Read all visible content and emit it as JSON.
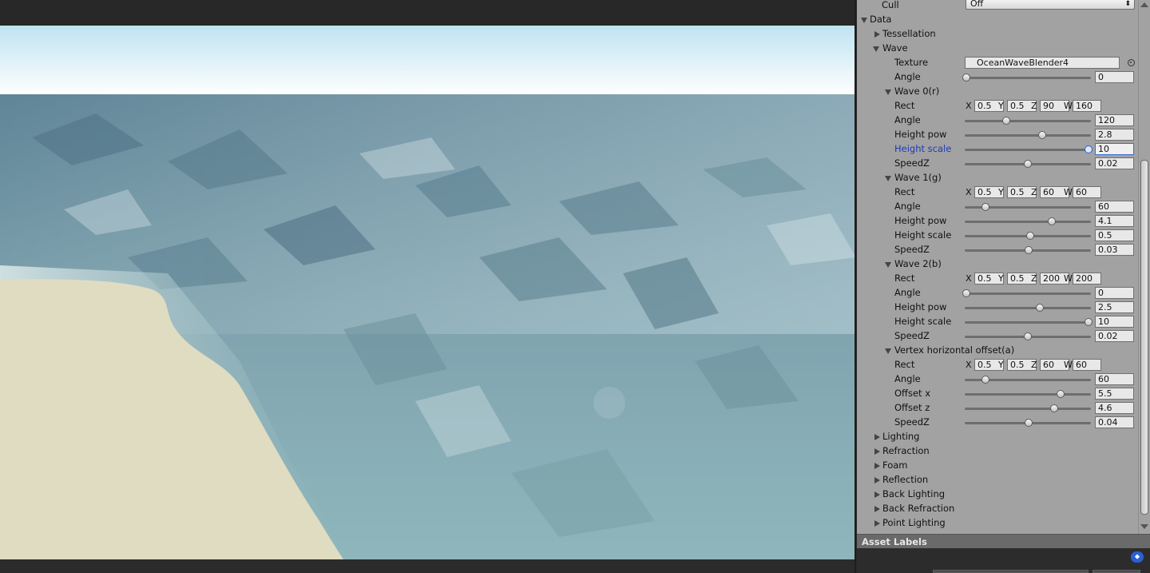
{
  "inspector": {
    "cull": {
      "label": "Cull",
      "value": "Off"
    },
    "data_section": "Data",
    "tessellation": "Tessellation",
    "wave_section": "Wave",
    "texture": {
      "label": "Texture",
      "value": "OceanWaveBlender4"
    },
    "global_angle": {
      "label": "Angle",
      "value": "0",
      "fraction": 0.0
    },
    "waves": [
      {
        "title": "Wave 0(r)",
        "rect": {
          "label": "Rect",
          "x": "0.5",
          "y": "0.5",
          "z": "90",
          "w": "160"
        },
        "sliders": [
          {
            "label": "Angle",
            "value": "120",
            "fraction": 0.33
          },
          {
            "label": "Height pow",
            "value": "2.8",
            "fraction": 0.62
          },
          {
            "label": "Height scale",
            "value": "10",
            "fraction": 1.0,
            "focused": true
          },
          {
            "label": "SpeedZ",
            "value": "0.02",
            "fraction": 0.5
          }
        ]
      },
      {
        "title": "Wave 1(g)",
        "rect": {
          "label": "Rect",
          "x": "0.5",
          "y": "0.5",
          "z": "60",
          "w": "60"
        },
        "sliders": [
          {
            "label": "Angle",
            "value": "60",
            "fraction": 0.16
          },
          {
            "label": "Height pow",
            "value": "4.1",
            "fraction": 0.7
          },
          {
            "label": "Height scale",
            "value": "0.5",
            "fraction": 0.52
          },
          {
            "label": "SpeedZ",
            "value": "0.03",
            "fraction": 0.51
          }
        ]
      },
      {
        "title": "Wave 2(b)",
        "rect": {
          "label": "Rect",
          "x": "0.5",
          "y": "0.5",
          "z": "200",
          "w": "200"
        },
        "sliders": [
          {
            "label": "Angle",
            "value": "0",
            "fraction": 0.0
          },
          {
            "label": "Height pow",
            "value": "2.5",
            "fraction": 0.6
          },
          {
            "label": "Height scale",
            "value": "10",
            "fraction": 1.0
          },
          {
            "label": "SpeedZ",
            "value": "0.02",
            "fraction": 0.5
          }
        ]
      },
      {
        "title": "Vertex horizontal offset(a)",
        "rect": {
          "label": "Rect",
          "x": "0.5",
          "y": "0.5",
          "z": "60",
          "w": "60"
        },
        "sliders": [
          {
            "label": "Angle",
            "value": "60",
            "fraction": 0.16
          },
          {
            "label": "Offset x",
            "value": "5.5",
            "fraction": 0.77
          },
          {
            "label": "Offset z",
            "value": "4.6",
            "fraction": 0.72
          },
          {
            "label": "SpeedZ",
            "value": "0.04",
            "fraction": 0.51
          }
        ]
      }
    ],
    "rect_axes": {
      "x": "X",
      "y": "Y",
      "z": "Z",
      "w": "W"
    },
    "collapsed_sections": [
      "Lighting",
      "Refraction",
      "Foam",
      "Reflection",
      "Back Lighting",
      "Back Refraction",
      "Point Lighting"
    ],
    "asset_labels": "Asset Labels"
  },
  "colors": {
    "inspector_bg": "#a2a2a2",
    "focus_blue": "#1c3db7",
    "sand": "#e0dcc2",
    "sea": "#7fa3ad",
    "sky": "#bfe4f2"
  }
}
